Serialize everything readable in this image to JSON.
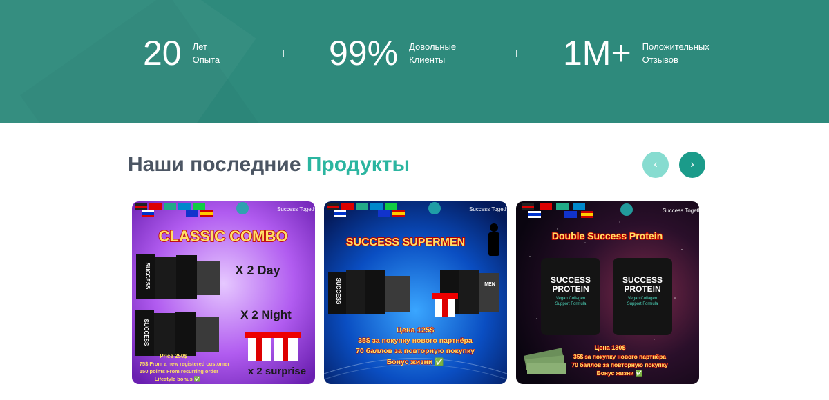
{
  "stats": [
    {
      "number": "20",
      "label_line1": "Лет",
      "label_line2": "Опыта"
    },
    {
      "number": "99%",
      "label_line1": "Довольные",
      "label_line2": "Клиенты"
    },
    {
      "number": "1M+",
      "label_line1": "Положительных",
      "label_line2": "Отзывов"
    }
  ],
  "section": {
    "title_part1": "Наши последние",
    "title_part2": "Продукты"
  },
  "carousel": {
    "prev_symbol": "‹",
    "next_symbol": "›"
  },
  "brand": "Success Together",
  "products": [
    {
      "headline": "CLASSIC COMBO",
      "line_a": "X 2 Day",
      "line_b": "X 2 Night",
      "price": "Price 250$",
      "promo1": "75$ From a new registered customer",
      "promo2": "150 points From recurring order",
      "promo3": "Lifestyle bonus ✅",
      "extra": "x 2 surprise",
      "box_label": "SUCCESS"
    },
    {
      "headline": "SUCCESS SUPERMEN",
      "price": "Цена 125$",
      "promo1": "35$ за покупку нового партнёра",
      "promo2": "70 баллов за повторную покупку",
      "promo3": "Бонус жизни ✅",
      "box_label": "SUCCESS",
      "box_label2": "MEN"
    },
    {
      "headline": "Double Success Protein",
      "pouch_title1": "SUCCESS",
      "pouch_title2": "PROTEIN",
      "pouch_sub1": "Vegan Collagen",
      "pouch_sub2": "Support Formula",
      "price": "Цена 130$",
      "promo1": "35$ за покупку нового партнёра",
      "promo2": "70 баллов за повторную покупку",
      "promo3": "Бонус жизни ✅"
    }
  ],
  "colors": {
    "band": "#2e8a7c",
    "accent": "#2bb5a0",
    "title": "#4b5563",
    "nav_prev": "#87dcd0",
    "nav_next": "#1b9b8a"
  }
}
